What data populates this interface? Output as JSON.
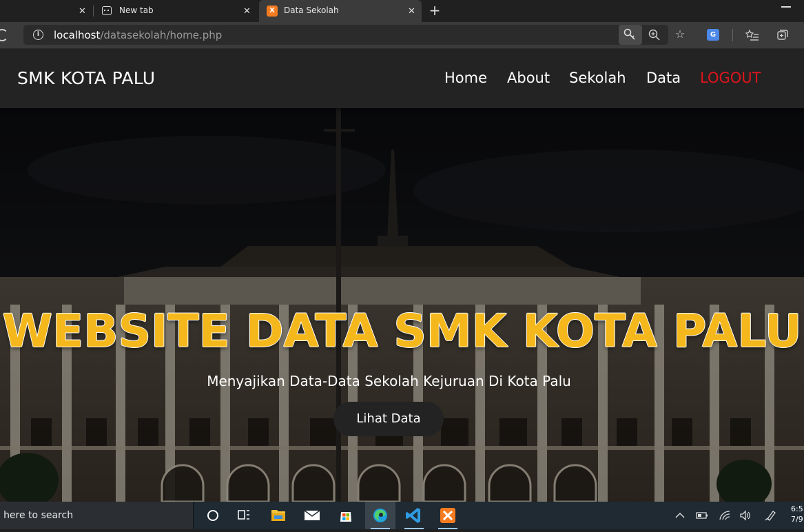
{
  "browser": {
    "tabs": [
      {
        "label": "",
        "close": "✕"
      },
      {
        "label": "New tab",
        "close": "✕"
      },
      {
        "label": "Data Sekolah",
        "close": "✕"
      }
    ],
    "new_tab": "+",
    "url_host": "localhost",
    "url_path": "/datasekolah/home.php"
  },
  "site": {
    "brand": "SMK KOTA PALU",
    "nav": {
      "home": "Home",
      "about": "About",
      "sekolah": "Sekolah",
      "data": "Data",
      "logout": "LOGOUT"
    },
    "hero": {
      "title": "WEBSITE DATA SMK KOTA PALU",
      "subtitle": "Menyajikan Data-Data Sekolah Kejuruan Di Kota Palu",
      "button": "Lihat Data"
    },
    "colors": {
      "accent": "#f5b81c",
      "logout": "#e0141c",
      "navbar": "#232323"
    }
  },
  "taskbar": {
    "search_placeholder": "e here to search",
    "clock_time": "6:5",
    "clock_date": "7/9"
  }
}
